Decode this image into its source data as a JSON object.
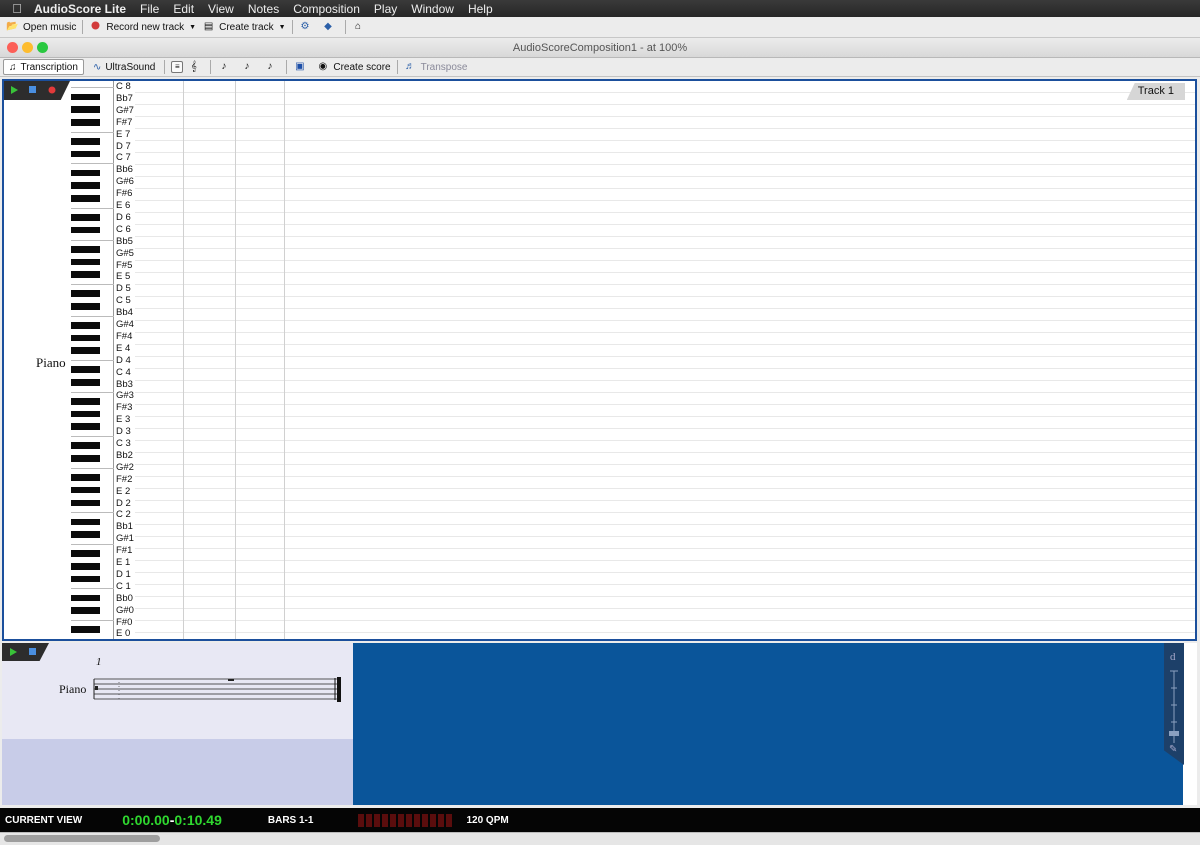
{
  "menubar": {
    "app_name": "AudioScore Lite",
    "items": [
      "File",
      "Edit",
      "View",
      "Notes",
      "Composition",
      "Play",
      "Window",
      "Help"
    ]
  },
  "app_toolbar": {
    "open_music": "Open music",
    "record_new_track": "Record new track",
    "create_track": "Create track"
  },
  "window": {
    "title": "AudioScoreComposition1 - at 100%",
    "toolbar": {
      "transcription": "Transcription",
      "ultrasound": "UltraSound",
      "create_score": "Create score",
      "transpose": "Transpose",
      "view_mode": "Transcription"
    }
  },
  "track": {
    "label": "Track 1",
    "instrument": "Piano",
    "note_labels": [
      "C 8",
      "Bb7",
      "G#7",
      "F#7",
      "E 7",
      "D 7",
      "C 7",
      "Bb6",
      "G#6",
      "F#6",
      "E 6",
      "D 6",
      "C 6",
      "Bb5",
      "G#5",
      "F#5",
      "E 5",
      "D 5",
      "C 5",
      "Bb4",
      "G#4",
      "F#4",
      "E 4",
      "D 4",
      "C 4",
      "Bb3",
      "G#3",
      "F#3",
      "E 3",
      "D 3",
      "C 3",
      "Bb2",
      "G#2",
      "F#2",
      "E 2",
      "D 2",
      "C 2",
      "Bb1",
      "G#1",
      "F#1",
      "E 1",
      "D 1",
      "C 1",
      "Bb0",
      "G#0",
      "F#0",
      "E 0"
    ]
  },
  "score": {
    "bar_number": "1",
    "instrument": "Piano"
  },
  "status": {
    "current_view": "CURRENT VIEW",
    "time_start": "0:00.00",
    "time_sep": "-",
    "time_end": "0:10.49",
    "bars": "BARS 1-1",
    "tempo": "120 QPM",
    "level_segments": 12
  },
  "colors": {
    "accent": "#0a559a",
    "time": "#2fd82f",
    "meter_off": "#5a0d0d",
    "panel_border": "#1b4f9c"
  }
}
